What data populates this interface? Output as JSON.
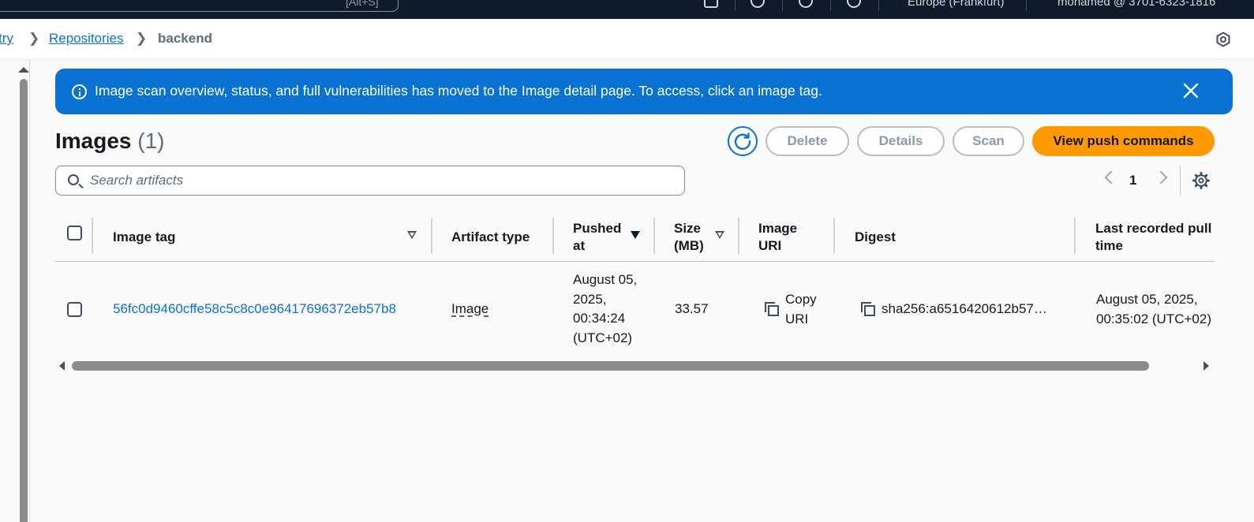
{
  "topnav": {
    "search_shortcut": "[Alt+S]",
    "region": "Europe (Frankfurt)",
    "account": "mohamed @ 3701-6323-1816"
  },
  "breadcrumb": {
    "items": [
      "try",
      "Repositories"
    ],
    "current": "backend"
  },
  "flash": {
    "message": "Image scan overview, status, and full vulnerabilities has moved to the Image detail page. To access, click an image tag."
  },
  "header": {
    "title": "Images",
    "count": "(1)",
    "buttons": {
      "delete": "Delete",
      "details": "Details",
      "scan": "Scan",
      "push": "View push commands"
    }
  },
  "search": {
    "placeholder": "Search artifacts",
    "value": ""
  },
  "pagination": {
    "current_page": "1"
  },
  "table": {
    "columns": {
      "image_tag": "Image tag",
      "artifact_type": "Artifact type",
      "pushed_at": "Pushed at",
      "size": "Size (MB)",
      "image_uri": "Image URI",
      "digest": "Digest",
      "last_pull": "Last recorded pull time"
    },
    "rows": [
      {
        "image_tag": "56fc0d9460cffe58c5c8c0e96417696372eb57b8",
        "artifact_type": "Image",
        "pushed_at": "August 05, 2025, 00:34:24 (UTC+02)",
        "size": "33.57",
        "image_uri": "Copy URI",
        "digest": "sha256:a6516420612b57…",
        "last_pull": "August 05, 2025, 00:35:02 (UTC+02)"
      }
    ]
  },
  "colors": {
    "link": "#0972d3",
    "info_banner": "#0972d3",
    "primary_button": "#ff9900",
    "nav_bg": "#0f1b2a"
  }
}
